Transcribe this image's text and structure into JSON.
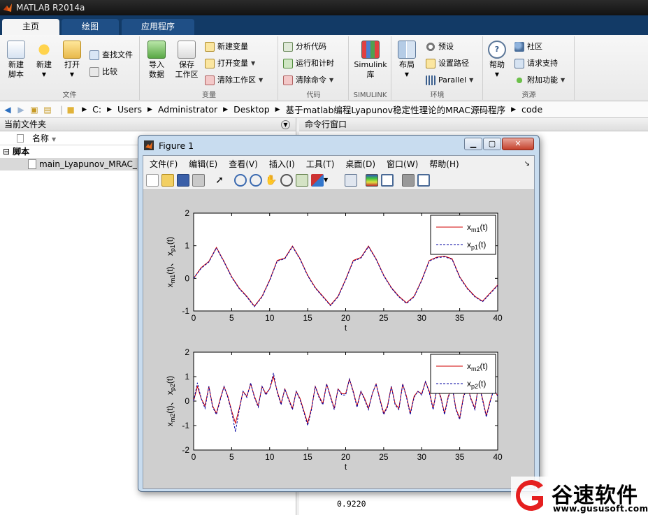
{
  "app": {
    "title": "MATLAB R2014a"
  },
  "tabs": [
    "主页",
    "绘图",
    "应用程序"
  ],
  "ribbon": {
    "file": {
      "section": "文件",
      "new_script": "新建\n脚本",
      "new": "新建",
      "open": "打开",
      "find_files": "查找文件",
      "compare": "比较"
    },
    "variable": {
      "section": "变量",
      "import": "导入\n数据",
      "save_ws": "保存\n工作区",
      "new_var": "新建变量",
      "open_var": "打开变量",
      "clear_ws": "清除工作区"
    },
    "code": {
      "section": "代码",
      "analyze": "分析代码",
      "run_time": "运行和计时",
      "clear_cmds": "清除命令"
    },
    "simulink": {
      "section": "SIMULINK",
      "library": "Simulink\n库"
    },
    "env": {
      "section": "环境",
      "layout": "布局",
      "prefs": "预设",
      "set_path": "设置路径",
      "parallel": "Parallel"
    },
    "resources": {
      "section": "资源",
      "help": "帮助",
      "community": "社区",
      "support": "请求支持",
      "addons": "附加功能"
    }
  },
  "address": {
    "crumbs": [
      "C:",
      "Users",
      "Administrator",
      "Desktop",
      "基于matlab编程Lyapunov稳定性理论的MRAC源码程序",
      "code"
    ]
  },
  "left_panel": {
    "title": "当前文件夹",
    "column": "名称",
    "group": "脚本",
    "file": "main_Lyapunov_MRAC_"
  },
  "right_panel": {
    "title": "命令行窗口",
    "value": "0.9220"
  },
  "figure": {
    "title": "Figure 1",
    "menu": [
      "文件(F)",
      "编辑(E)",
      "查看(V)",
      "插入(I)",
      "工具(T)",
      "桌面(D)",
      "窗口(W)",
      "帮助(H)"
    ]
  },
  "colors": {
    "model": "#d00000",
    "plant": "#0000a0",
    "tab_bg": "#123a66",
    "figure_frame": "#c8dcef"
  },
  "chart_data": [
    {
      "type": "line",
      "xlabel": "t",
      "ylabel": "x_m1(t)、 x_p1(t)",
      "xlim": [
        0,
        40
      ],
      "ylim": [
        -1,
        2
      ],
      "xticks": [
        0,
        5,
        10,
        15,
        20,
        25,
        30,
        35,
        40
      ],
      "yticks": [
        -1,
        0,
        1,
        2
      ],
      "legend_position": "top-right",
      "x": [
        0,
        1,
        2,
        3,
        4,
        5,
        6,
        7,
        8,
        9,
        10,
        11,
        12,
        13,
        14,
        15,
        16,
        17,
        18,
        19,
        20,
        21,
        22,
        23,
        24,
        25,
        26,
        27,
        28,
        29,
        30,
        31,
        32,
        33,
        34,
        35,
        36,
        37,
        38,
        39,
        40
      ],
      "series": [
        {
          "name": "x_m1(t)",
          "style": "solid",
          "values": [
            0,
            0.33,
            0.52,
            0.95,
            0.52,
            0.05,
            -0.3,
            -0.55,
            -0.85,
            -0.55,
            -0.05,
            0.55,
            0.62,
            0.99,
            0.6,
            0.1,
            -0.28,
            -0.55,
            -0.82,
            -0.55,
            -0.03,
            0.55,
            0.64,
            0.99,
            0.6,
            0.1,
            -0.28,
            -0.55,
            -0.75,
            -0.55,
            -0.05,
            0.55,
            0.65,
            0.68,
            0.6,
            0.05,
            -0.3,
            -0.55,
            -0.7,
            -0.45,
            -0.2
          ]
        },
        {
          "name": "x_p1(t)",
          "style": "dashed",
          "values": [
            0,
            0.31,
            0.5,
            0.93,
            0.5,
            0.03,
            -0.32,
            -0.57,
            -0.87,
            -0.57,
            -0.07,
            0.53,
            0.6,
            0.97,
            0.58,
            0.08,
            -0.3,
            -0.57,
            -0.84,
            -0.57,
            -0.05,
            0.53,
            0.62,
            0.97,
            0.58,
            0.08,
            -0.3,
            -0.57,
            -0.77,
            -0.57,
            -0.07,
            0.53,
            0.63,
            0.66,
            0.58,
            0.03,
            -0.32,
            -0.57,
            -0.72,
            -0.47,
            -0.22
          ]
        }
      ]
    },
    {
      "type": "line",
      "xlabel": "t",
      "ylabel": "x_m2(t)、 x_p2(t)",
      "xlim": [
        0,
        40
      ],
      "ylim": [
        -2,
        2
      ],
      "xticks": [
        0,
        5,
        10,
        15,
        20,
        25,
        30,
        35,
        40
      ],
      "yticks": [
        -2,
        -1,
        0,
        1,
        2
      ],
      "legend_position": "top-right",
      "x": [
        0,
        0.5,
        1,
        1.5,
        2,
        2.5,
        3,
        3.5,
        4,
        4.5,
        5,
        5.5,
        6,
        6.5,
        7,
        7.5,
        8,
        8.5,
        9,
        9.5,
        10,
        10.5,
        11,
        11.5,
        12,
        12.5,
        13,
        13.5,
        14,
        14.5,
        15,
        15.5,
        16,
        16.5,
        17,
        17.5,
        18,
        18.5,
        19,
        19.5,
        20,
        20.5,
        21,
        21.5,
        22,
        22.5,
        23,
        23.5,
        24,
        24.5,
        25,
        25.5,
        26,
        26.5,
        27,
        27.5,
        28,
        28.5,
        29,
        29.5,
        30,
        30.5,
        31,
        31.5,
        32,
        32.5,
        33,
        33.5,
        34,
        34.5,
        35,
        35.5,
        36,
        36.5,
        37,
        37.5,
        38,
        38.5,
        39,
        39.5,
        40
      ],
      "series": [
        {
          "name": "x_m2(t)",
          "style": "solid",
          "values": [
            0,
            0.6,
            0.1,
            -0.2,
            0.6,
            -0.2,
            -0.5,
            0.1,
            0.6,
            0.2,
            -0.4,
            -0.9,
            -0.3,
            0.4,
            0.2,
            0.7,
            0.2,
            -0.2,
            0.6,
            0.3,
            0.5,
            1.0,
            0.4,
            -0.1,
            0.5,
            0.1,
            -0.3,
            0.4,
            0.1,
            -0.4,
            -0.9,
            -0.3,
            0.6,
            0.2,
            -0.1,
            0.7,
            0.2,
            -0.3,
            0.5,
            0.3,
            0.3,
            0.9,
            0.4,
            -0.2,
            0.4,
            0.1,
            -0.3,
            0.3,
            0.7,
            0.1,
            -0.5,
            -0.2,
            0.6,
            -0.1,
            -0.3,
            0.7,
            0.2,
            -0.5,
            0.2,
            0.4,
            0.3,
            0.8,
            0.4,
            -0.3,
            0.5,
            0.2,
            -0.5,
            0.2,
            0.6,
            -0.3,
            -0.7,
            0.2,
            0.6,
            0.1,
            -0.3,
            0.7,
            0.1,
            -0.6,
            0,
            0.5,
            0.2
          ]
        },
        {
          "name": "x_p2(t)",
          "style": "dashed",
          "values": [
            0,
            0.75,
            0.1,
            -0.3,
            0.6,
            -0.25,
            -0.55,
            0.05,
            0.6,
            0.15,
            -0.45,
            -1.25,
            -0.35,
            0.4,
            0.15,
            0.75,
            0.15,
            -0.25,
            0.6,
            0.25,
            0.5,
            1.15,
            0.35,
            -0.15,
            0.5,
            0.05,
            -0.35,
            0.4,
            0.05,
            -0.45,
            -1.0,
            -0.35,
            0.6,
            0.15,
            -0.15,
            0.7,
            0.15,
            -0.35,
            0.5,
            0.25,
            0.25,
            0.9,
            0.35,
            -0.25,
            0.4,
            0.05,
            -0.35,
            0.3,
            0.7,
            0.05,
            -0.55,
            -0.25,
            0.6,
            -0.15,
            -0.35,
            0.7,
            0.15,
            -0.55,
            0.15,
            0.4,
            0.25,
            0.8,
            0.35,
            -0.35,
            0.5,
            0.15,
            -0.55,
            0.15,
            0.6,
            -0.35,
            -0.75,
            0.15,
            0.6,
            0.05,
            -0.35,
            0.7,
            0.05,
            -0.65,
            -0.05,
            0.5,
            0.2
          ]
        }
      ]
    }
  ],
  "watermark": {
    "brand": "谷速软件",
    "url": "www.gususoft.com"
  }
}
